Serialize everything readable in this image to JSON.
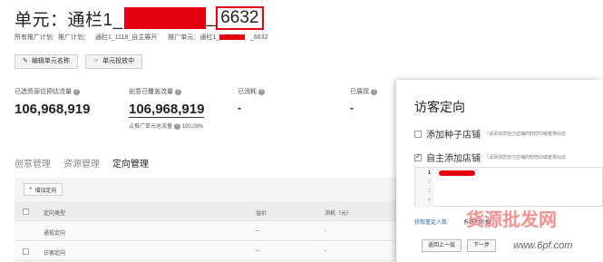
{
  "header": {
    "title_prefix": "单元：通栏1_",
    "title_suffix": "_",
    "title_boxed": "6632"
  },
  "breadcrumb": {
    "all_plans": "所有推广计划",
    "plan_prefix": "推广计划：",
    "plan_name": "通栏1_1118_自主展开",
    "unit_prefix": "推广单元：通栏1_",
    "unit_suffix": "_6632"
  },
  "toolbar": {
    "edit_name_label": "编辑单元名称",
    "delivery_label": "单元投放中"
  },
  "stats": {
    "selected_flow_label": "已选资源位预估流量",
    "selected_flow_value": "106,968,919",
    "covered_flow_label": "创意已覆盖流量",
    "covered_flow_value": "106,968,919",
    "share_label": "占推广单元总流量",
    "share_value": "100.00%",
    "consumed_label": "已消耗",
    "consumed_value": "-",
    "shown_label": "已展现",
    "shown_value": "-"
  },
  "tabs": [
    {
      "label": "创意管理"
    },
    {
      "label": "资源管理"
    },
    {
      "label": "定向管理"
    }
  ],
  "table": {
    "add_label": "增加定向",
    "headers": [
      "定向类型",
      "溢价",
      "消耗（元）"
    ],
    "rows": [
      {
        "type": "通投定向",
        "premium": "--",
        "cost": "-"
      },
      {
        "type": "访客定向",
        "premium": "--",
        "cost": "-"
      }
    ]
  },
  "modal": {
    "title": "访客定向",
    "seed_label": "添加种子店铺",
    "seed_hint": "（请添加您自己店铺的旺旺ID或者类似店",
    "self_label": "自主添加店铺",
    "self_hint": "（请添加您自己店铺的旺旺ID或者类似店",
    "line_numbers": [
      "1",
      "2",
      "3",
      "4"
    ],
    "recommend_link": "获取重定人数",
    "system_text": "系统为你推",
    "prev_button": "返回上一层",
    "next_button": "下一步"
  },
  "watermark": {
    "text": "货源批发网",
    "url": "www.6pf.com"
  },
  "colors": {
    "redaction": "#e3000f",
    "link": "#2e6cb5"
  }
}
